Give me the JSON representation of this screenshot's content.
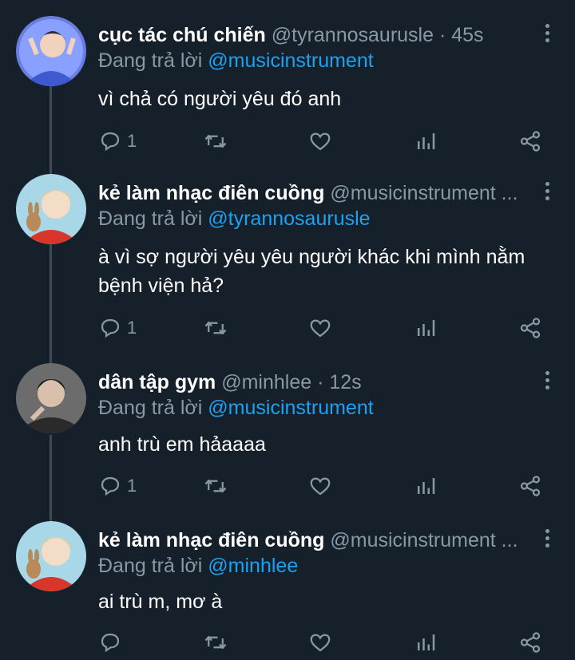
{
  "reply_prefix": "Đang trả lời",
  "tweets": [
    {
      "name": "cục tác chú chiến",
      "handle_line": "@tyrannosaurusle · 45s",
      "reply_to": "@musicinstrument",
      "text": "vì chả có người yêu đó anh",
      "reply_count": "1"
    },
    {
      "name": "kẻ làm nhạc điên cuồng",
      "handle_line": "@musicinstrument ...",
      "reply_to": "@tyrannosaurusle",
      "text": "à vì sợ người yêu yêu người khác khi mình nằm bệnh viện hả?",
      "reply_count": "1"
    },
    {
      "name": "dân tập gym",
      "handle_line": "@minhlee · 12s",
      "reply_to": "@musicinstrument",
      "text": "anh trù em hảaaaa",
      "reply_count": "1"
    },
    {
      "name": "kẻ làm nhạc điên cuồng",
      "handle_line": "@musicinstrument ...",
      "reply_to": "@minhlee",
      "text": "ai trù m, mơ à",
      "reply_count": ""
    }
  ],
  "icons": {
    "reply": "reply-icon",
    "retweet": "retweet-icon",
    "like": "heart-icon",
    "analytics": "analytics-icon",
    "share": "share-icon",
    "more": "more-vertical-icon"
  },
  "colors": {
    "background": "#15202b",
    "secondary_text": "#8899a6",
    "link": "#1da1f2",
    "thread_line": "#3d4b59"
  }
}
